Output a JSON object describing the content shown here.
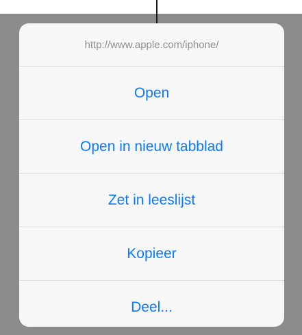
{
  "menu": {
    "url": "http://www.apple.com/iphone/",
    "actions": [
      {
        "label": "Open"
      },
      {
        "label": "Open in nieuw tabblad"
      },
      {
        "label": "Zet in leeslijst"
      },
      {
        "label": "Kopieer"
      },
      {
        "label": "Deel..."
      }
    ]
  },
  "colors": {
    "accent": "#0a7aff",
    "url_text": "#8e8e93",
    "sheet_background": "#f7f7f7",
    "dimmed_backdrop": "#8c8c8c"
  }
}
